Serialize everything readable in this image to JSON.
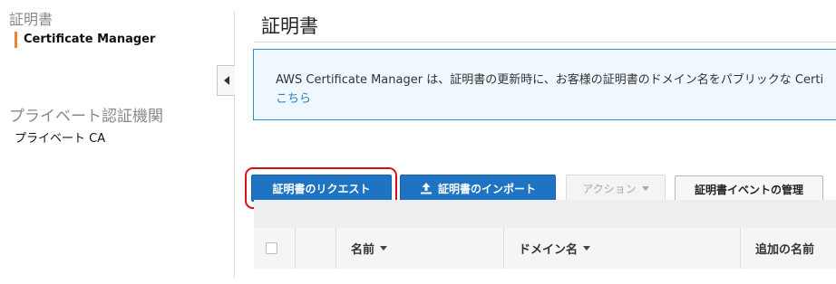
{
  "sidebar": {
    "section1_title": "証明書",
    "item_certificate_manager": "Certificate Manager",
    "section2_title": "プライベート認証機関",
    "item_private_ca": "プライベート CA",
    "accent_color": "#e8862b"
  },
  "main": {
    "page_title": "証明書",
    "info": {
      "text": "AWS Certificate Manager は、証明書の更新時に、お客様の証明書のドメイン名をパブリックな Certi",
      "link": "こちら"
    },
    "toolbar": {
      "request_label": "証明書のリクエスト",
      "import_label": "証明書のインポート",
      "import_icon": "upload-icon",
      "actions_label": "アクション",
      "events_label": "証明書イベントの管理"
    },
    "table": {
      "columns": [
        "名前",
        "ドメイン名",
        "追加の名前"
      ]
    }
  },
  "colors": {
    "primary": "#1e73c3",
    "highlight": "#d6111b",
    "link": "#2a7dc1",
    "info_border": "#2f8fd3"
  }
}
